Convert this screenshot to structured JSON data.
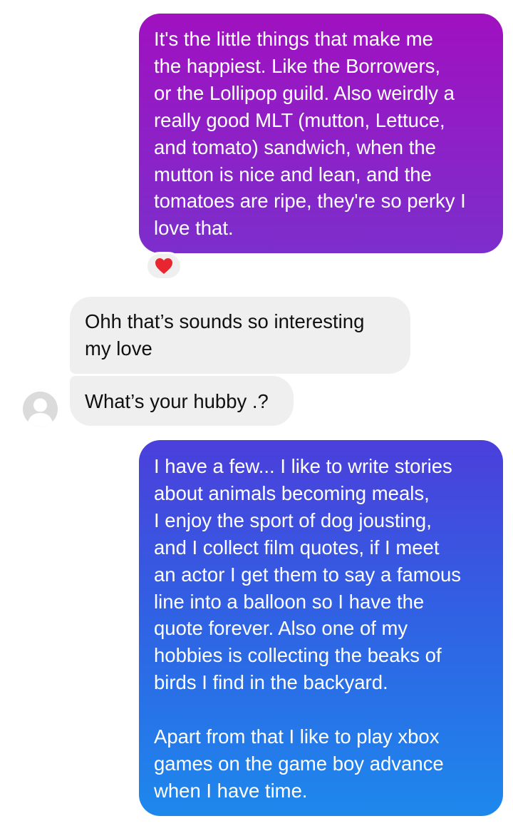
{
  "messages": [
    {
      "sender": "me",
      "text": "It's the little things that make me\nthe happiest. Like the Borrowers,\nor the Lollipop guild. Also weirdly a\nreally good MLT (mutton, Lettuce,\nand tomato) sandwich, when the\nmutton is nice and lean, and the\ntomatoes are ripe, they're so perky I\nlove that.",
      "reaction": "heart-icon"
    },
    {
      "sender": "them",
      "text": "Ohh that’s sounds so interesting\nmy love"
    },
    {
      "sender": "them",
      "text": "What’s your hubby .?"
    },
    {
      "sender": "me",
      "paragraph_1": "I have a few... I like to write stories\nabout animals becoming meals,\nI enjoy the sport of dog jousting,\nand I collect film quotes, if I meet\nan actor I get them to say a famous\nline into a balloon so I have the\nquote forever. Also one of my\nhobbies is collecting the beaks of\nbirds I find in the backyard.",
      "paragraph_2": "Apart from that I like to play xbox\ngames on the game boy advance\nwhen I have time."
    }
  ],
  "colors": {
    "outgoing_gradient_top_1": "#a011c0",
    "outgoing_gradient_bottom_1": "#7c2ecc",
    "outgoing_gradient_top_2": "#4b3fdb",
    "outgoing_gradient_bottom_2": "#1d88ec",
    "incoming_bubble": "#efefef",
    "heart": "#e8262f"
  }
}
